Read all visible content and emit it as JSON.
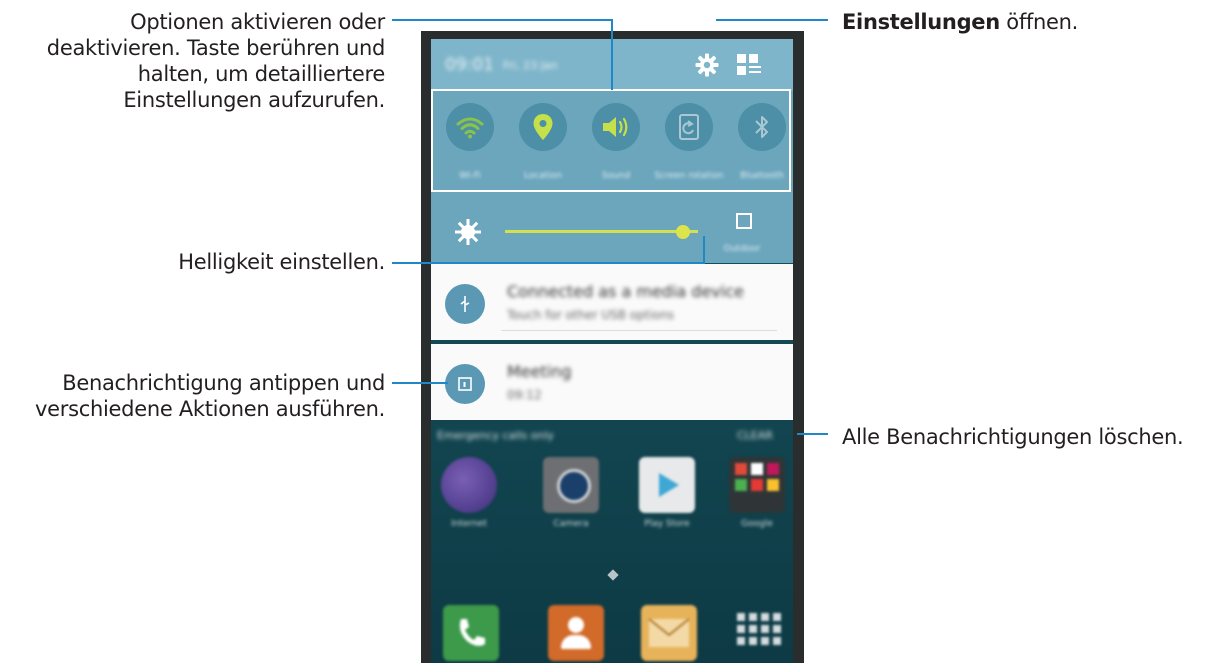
{
  "callouts": {
    "quick_settings": [
      "Optionen aktivieren oder",
      "deaktivieren. Taste berühren und",
      "halten, um detailliertere",
      "Einstellungen aufzurufen."
    ],
    "settings_bold": "Einstellungen",
    "settings_rest": " öffnen.",
    "brightness": "Helligkeit einstellen.",
    "notification": [
      "Benachrichtigung antippen und",
      "verschiedene Aktionen ausführen."
    ],
    "clear_all": "Alle Benachrichtigungen löschen."
  },
  "phone": {
    "status_time": "09:01",
    "status_date": "Fri, 23 Jan",
    "quick_settings": [
      {
        "label": "Wi-Fi",
        "icon": "wifi-icon",
        "color": "#8bc34a"
      },
      {
        "label": "Location",
        "icon": "location-icon",
        "color": "#c5e04a"
      },
      {
        "label": "Sound",
        "icon": "sound-icon",
        "color": "#c5e04a"
      },
      {
        "label": "Screen rotation",
        "icon": "rotate-icon",
        "color": "#a9c8d4"
      },
      {
        "label": "Bluetooth",
        "icon": "bluetooth-icon",
        "color": "#a9c8d4"
      }
    ],
    "brightness_level": 0.92,
    "auto_label": "Outdoor",
    "notifications": [
      {
        "title": "Connected as a media device",
        "subtitle": "Touch for other USB options",
        "icon": "usb-icon"
      },
      {
        "title": "Meeting",
        "subtitle": "09:12",
        "icon": "calendar-icon"
      }
    ],
    "carrier": "Emergency calls only",
    "clear_label": "CLEAR",
    "apps_row1": [
      "Internet",
      "Camera",
      "Play Store",
      "Google"
    ],
    "accent": "#1e88c9"
  }
}
